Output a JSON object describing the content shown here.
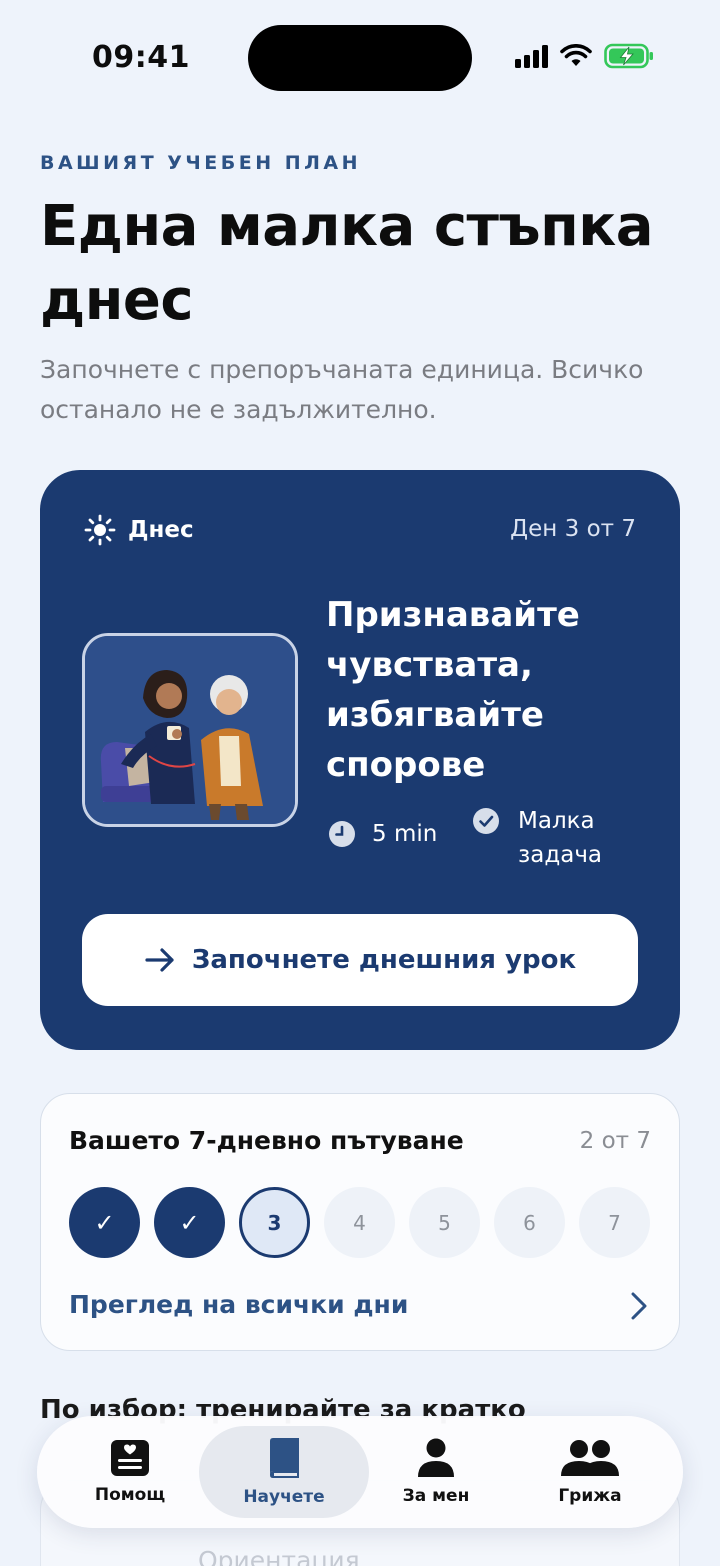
{
  "status_bar": {
    "time": "09:41"
  },
  "header": {
    "eyebrow": "ВАШИЯТ УЧЕБЕН ПЛАН",
    "title": "Една малка стъпка днес",
    "subtitle": "Започнете с препоръчаната единица. Всичко останало не е задължително."
  },
  "today_card": {
    "tag": "Днес",
    "day_counter": "Ден 3 от 7",
    "lesson_title": "Признавайте чувствата, избягвайте спорове",
    "duration": "5 min",
    "task": "Малка задача",
    "cta": "Започнете днешния урок"
  },
  "journey": {
    "title": "Вашето 7-дневно пътуване",
    "progress": "2 от 7",
    "days": [
      {
        "label": "✓",
        "state": "done"
      },
      {
        "label": "✓",
        "state": "done"
      },
      {
        "label": "3",
        "state": "current"
      },
      {
        "label": "4",
        "state": "future"
      },
      {
        "label": "5",
        "state": "future"
      },
      {
        "label": "6",
        "state": "future"
      },
      {
        "label": "7",
        "state": "future"
      }
    ],
    "link": "Преглед на всички дни"
  },
  "optional": {
    "heading": "По избор: тренирайте за кратко",
    "item": "Ориентация"
  },
  "tabs": [
    {
      "label": "Помощ",
      "icon": "help-card-icon",
      "active": false
    },
    {
      "label": "Научете",
      "icon": "book-icon",
      "active": true
    },
    {
      "label": "За мен",
      "icon": "person-icon",
      "active": false
    },
    {
      "label": "Грижа",
      "icon": "people-icon",
      "active": false
    }
  ],
  "colors": {
    "background": "#eef3fb",
    "primary": "#1b3a70",
    "accent_text": "#2d5285",
    "battery": "#34c759"
  }
}
